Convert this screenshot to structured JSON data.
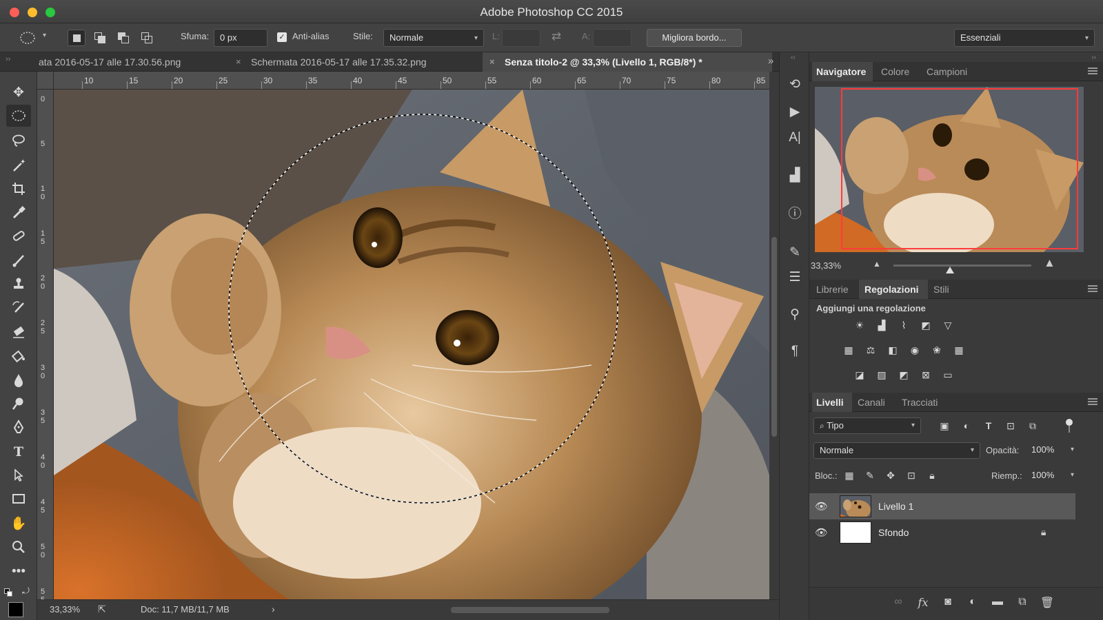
{
  "window": {
    "title": "Adobe Photoshop CC 2015"
  },
  "options_bar": {
    "feather_label": "Sfuma:",
    "feather_value": "0 px",
    "antialias_label": "Anti-alias",
    "style_label": "Stile:",
    "style_value": "Normale",
    "width_label": "L:",
    "height_label": "A:",
    "refine_edge_label": "Migliora bordo...",
    "workspace_value": "Essenziali"
  },
  "tabs": [
    {
      "label": "ata 2016-05-17 alle 17.30.56.png"
    },
    {
      "label": "Schermata 2016-05-17 alle 17.35.32.png"
    },
    {
      "label": "Senza titolo-2 @ 33,3% (Livello 1, RGB/8*) *"
    }
  ],
  "tabs_overflow": "»",
  "ruler_top_ticks": [
    "10",
    "15",
    "20",
    "25",
    "30",
    "35",
    "40",
    "45",
    "50",
    "55",
    "60",
    "65",
    "70",
    "75",
    "80",
    "85"
  ],
  "ruler_left_ticks": [
    "0",
    "5",
    "1 0",
    "1 5",
    "2 0",
    "2 5",
    "3 0",
    "3 5",
    "4 0",
    "4 5",
    "5 0",
    "5 5"
  ],
  "status": {
    "zoom": "33,33%",
    "doc": "Doc: 11,7 MB/11,7 MB",
    "arrow": "›"
  },
  "navigator": {
    "tabs": [
      "Navigatore",
      "Colore",
      "Campioni"
    ],
    "zoom": "33,33%"
  },
  "adjustments": {
    "tabs": [
      "Librerie",
      "Regolazioni",
      "Stili"
    ],
    "title": "Aggiungi una regolazione"
  },
  "layers_panel": {
    "tabs": [
      "Livelli",
      "Canali",
      "Tracciati"
    ],
    "filter_value": "Tipo",
    "blend_value": "Normale",
    "opacity_label": "Opacità:",
    "opacity_value": "100%",
    "lock_label": "Bloc.:",
    "fill_label": "Riemp.:",
    "fill_value": "100%",
    "layers": [
      {
        "name": "Livello 1",
        "selected": true
      },
      {
        "name": "Sfondo",
        "selected": false
      }
    ]
  },
  "colors": {
    "accent_red": "#ff3b3b",
    "panel_bg": "#3a3a3a",
    "toolbar_bg": "#434343"
  }
}
